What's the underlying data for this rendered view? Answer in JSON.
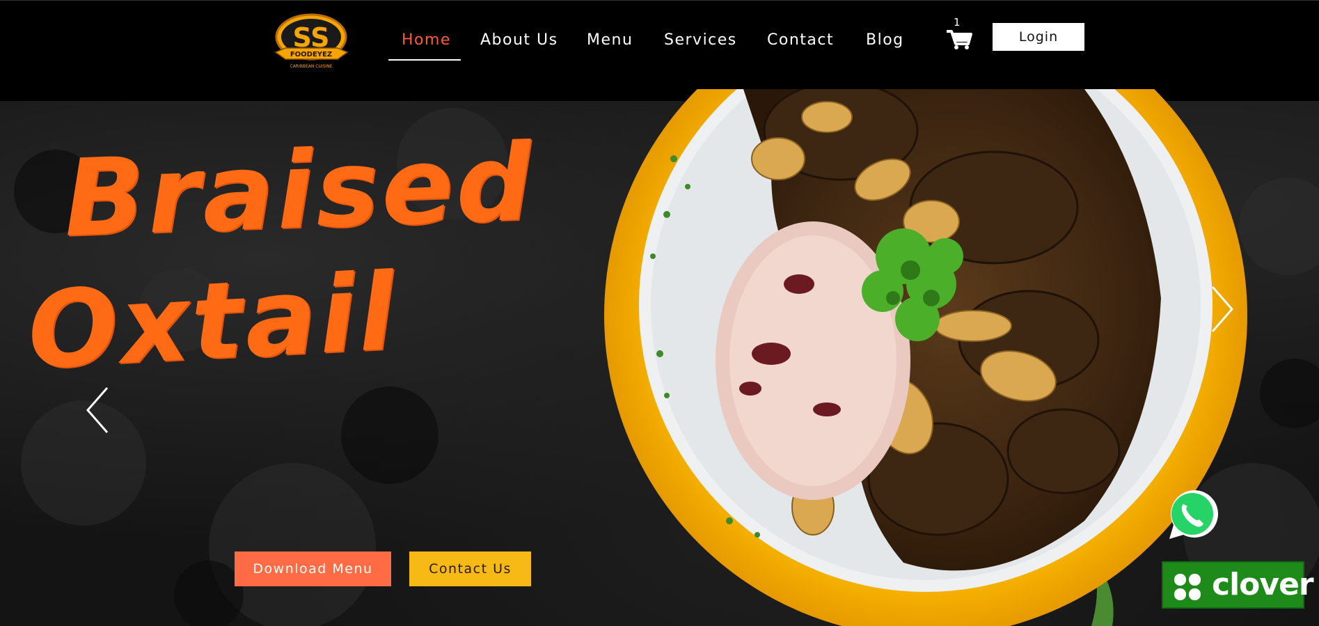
{
  "brand": {
    "logo_text": "SS",
    "logo_banner": "FOODEYEZ",
    "logo_tagline": "CARIBBEAN CUISINE"
  },
  "nav": {
    "items": [
      {
        "label": "Home",
        "active": true
      },
      {
        "label": "About Us",
        "active": false
      },
      {
        "label": "Menu",
        "active": false
      },
      {
        "label": "Services",
        "active": false
      },
      {
        "label": "Contact",
        "active": false
      },
      {
        "label": "Blog",
        "active": false
      }
    ],
    "cart_count": "1",
    "login_label": "Login"
  },
  "hero": {
    "headline_line1": "Braised",
    "headline_line2": "Oxtail",
    "download_menu_label": "Download Menu",
    "contact_us_label": "Contact Us"
  },
  "widgets": {
    "clover_label": "clover"
  },
  "colors": {
    "accent_orange": "#ff6a14",
    "nav_active": "#ff5a36",
    "button_orange": "#ff6b45",
    "button_yellow": "#f6b916",
    "clover_green": "#1e8a19",
    "whatsapp_green": "#25d366"
  },
  "icons": [
    "cart-icon",
    "prev-arrow-icon",
    "next-arrow-icon",
    "whatsapp-icon",
    "clover-icon"
  ]
}
